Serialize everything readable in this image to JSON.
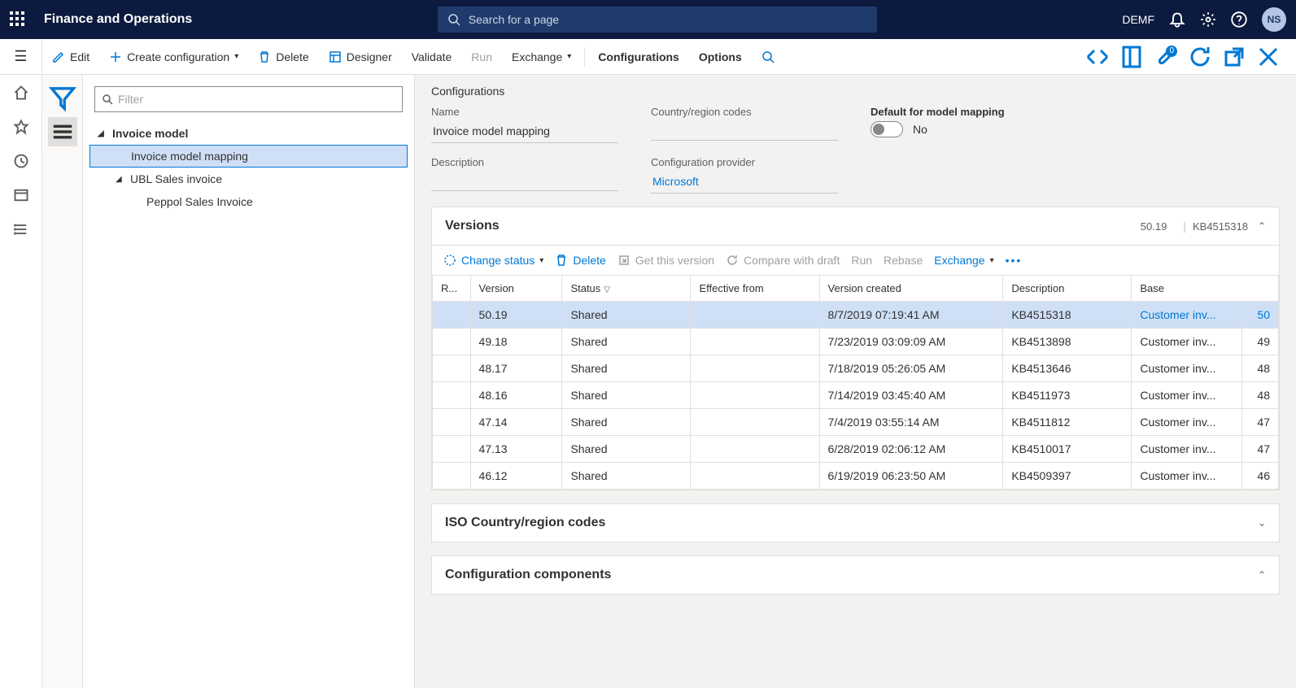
{
  "topbar": {
    "title": "Finance and Operations",
    "search_placeholder": "Search for a page",
    "company": "DEMF",
    "avatar_initials": "NS"
  },
  "cmdbar": {
    "edit": "Edit",
    "create": "Create configuration",
    "delete": "Delete",
    "designer": "Designer",
    "validate": "Validate",
    "run": "Run",
    "exchange": "Exchange",
    "configurations": "Configurations",
    "options": "Options",
    "attach_badge": "0"
  },
  "tree": {
    "filter_placeholder": "Filter",
    "root": "Invoice model",
    "child1": "Invoice model mapping",
    "child2": "UBL Sales invoice",
    "child3": "Peppol Sales Invoice"
  },
  "details": {
    "heading": "Configurations",
    "name_label": "Name",
    "name_value": "Invoice model mapping",
    "country_label": "Country/region codes",
    "country_value": "",
    "default_label": "Default for model mapping",
    "default_value": "No",
    "desc_label": "Description",
    "desc_value": "",
    "provider_label": "Configuration provider",
    "provider_value": "Microsoft"
  },
  "versions": {
    "title": "Versions",
    "summary_version": "50.19",
    "summary_kb": "KB4515318",
    "toolbar": {
      "change_status": "Change status",
      "delete": "Delete",
      "get": "Get this version",
      "compare": "Compare with draft",
      "run": "Run",
      "rebase": "Rebase",
      "exchange": "Exchange"
    },
    "columns": {
      "r": "R...",
      "version": "Version",
      "status": "Status",
      "effective": "Effective from",
      "created": "Version created",
      "description": "Description",
      "base": "Base"
    },
    "rows": [
      {
        "version": "50.19",
        "status": "Shared",
        "effective": "",
        "created": "8/7/2019 07:19:41 AM",
        "desc": "KB4515318",
        "base": "Customer inv...",
        "basenum": "50"
      },
      {
        "version": "49.18",
        "status": "Shared",
        "effective": "",
        "created": "7/23/2019 03:09:09 AM",
        "desc": "KB4513898",
        "base": "Customer inv...",
        "basenum": "49"
      },
      {
        "version": "48.17",
        "status": "Shared",
        "effective": "",
        "created": "7/18/2019 05:26:05 AM",
        "desc": "KB4513646",
        "base": "Customer inv...",
        "basenum": "48"
      },
      {
        "version": "48.16",
        "status": "Shared",
        "effective": "",
        "created": "7/14/2019 03:45:40 AM",
        "desc": "KB4511973",
        "base": "Customer inv...",
        "basenum": "48"
      },
      {
        "version": "47.14",
        "status": "Shared",
        "effective": "",
        "created": "7/4/2019 03:55:14 AM",
        "desc": "KB4511812",
        "base": "Customer inv...",
        "basenum": "47"
      },
      {
        "version": "47.13",
        "status": "Shared",
        "effective": "",
        "created": "6/28/2019 02:06:12 AM",
        "desc": "KB4510017",
        "base": "Customer inv...",
        "basenum": "47"
      },
      {
        "version": "46.12",
        "status": "Shared",
        "effective": "",
        "created": "6/19/2019 06:23:50 AM",
        "desc": "KB4509397",
        "base": "Customer inv...",
        "basenum": "46"
      }
    ]
  },
  "iso": {
    "title": "ISO Country/region codes"
  },
  "components": {
    "title": "Configuration components"
  }
}
